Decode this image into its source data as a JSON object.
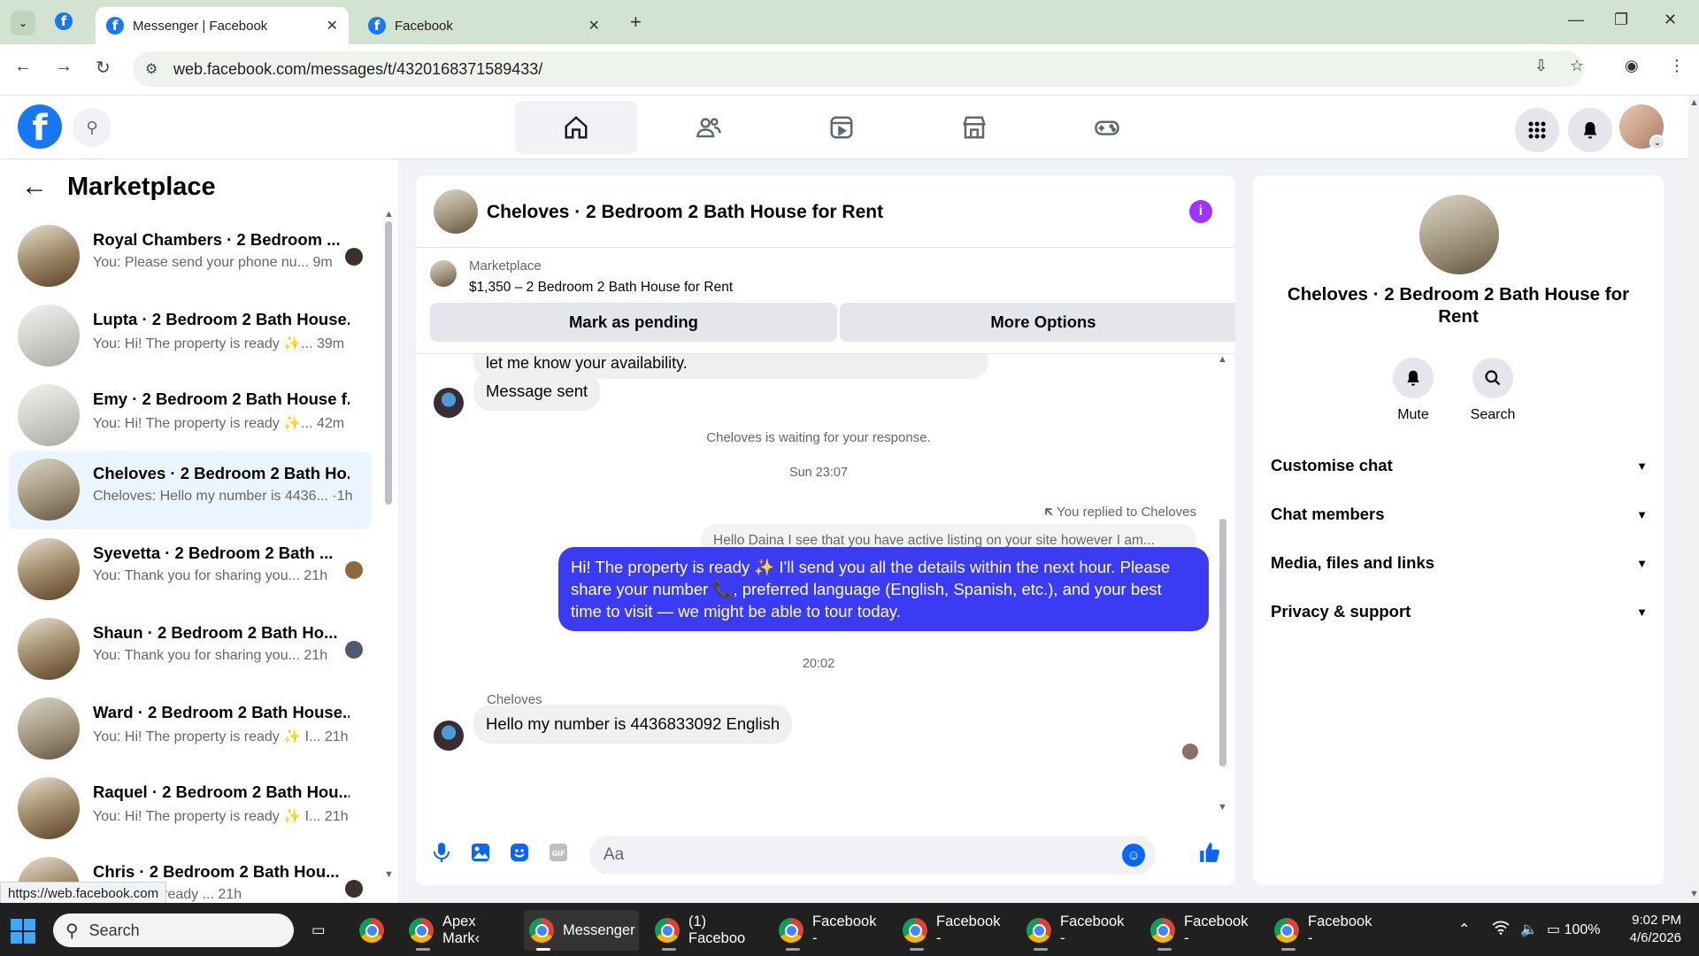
{
  "browser": {
    "tabs": [
      {
        "title": "Messenger | Facebook"
      },
      {
        "title": "Facebook"
      }
    ],
    "url": "web.facebook.com/messages/t/4320168371589433/",
    "status_url": "https://web.facebook.com"
  },
  "sidebar": {
    "title": "Marketplace",
    "conversations": [
      {
        "title": "Royal Chambers · 2 Bedroom ...",
        "preview": "You: Please send your phone nu...",
        "time": "9m"
      },
      {
        "title": "Lupta · 2 Bedroom 2 Bath House...",
        "preview": "You: Hi! The property is ready ✨...",
        "time": "39m"
      },
      {
        "title": "Emy · 2 Bedroom 2 Bath House f...",
        "preview": "You: Hi! The property is ready ✨...",
        "time": "42m"
      },
      {
        "title": "Cheloves · 2 Bedroom 2 Bath Ho...",
        "preview": "Cheloves: Hello my number is 4436...",
        "time": "·1h"
      },
      {
        "title": "Syevetta · 2 Bedroom 2 Bath ...",
        "preview": "You: Thank you for sharing you...",
        "time": "21h"
      },
      {
        "title": "Shaun · 2 Bedroom 2 Bath Ho...",
        "preview": "You: Thank you for sharing you...",
        "time": "21h"
      },
      {
        "title": "Ward · 2 Bedroom 2 Bath House...",
        "preview": "You: Hi! The property is ready ✨ I...",
        "time": "21h"
      },
      {
        "title": "Raquel · 2 Bedroom 2 Bath Hou...",
        "preview": "You: Hi! The property is ready ✨ I...",
        "time": "21h"
      },
      {
        "title": "Chris · 2 Bedroom 2 Bath Hou...",
        "preview": "property is ready ...",
        "time": "21h"
      }
    ]
  },
  "chat": {
    "title": "Cheloves · 2 Bedroom 2 Bath House for Rent",
    "marketplace_label": "Marketplace",
    "listing": "$1,350 – 2 Bedroom 2 Bath House for Rent",
    "mark_pending": "Mark as pending",
    "more_options": "More Options",
    "partial_msg": "let me know your availability.",
    "msg_sent": "Message sent",
    "waiting_note": "Cheloves is waiting for your response.",
    "time1": "Sun 23:07",
    "reply_note": "You replied to Cheloves",
    "quoted": "Hello Daina I see that you have active listing on your site however I am...",
    "outgoing": "Hi! The property is ready ✨ I'll send you all the details within the next hour. Please share your number 📞, preferred language (English, Spanish, etc.), and your best time to visit — we might be able to tour today.",
    "time2": "20:02",
    "sender": "Cheloves",
    "incoming": "Hello my number is 4436833092 English",
    "composer_placeholder": "Aa"
  },
  "details": {
    "title": "Cheloves · 2 Bedroom 2 Bath House for Rent",
    "mute": "Mute",
    "search": "Search",
    "rows": [
      "Customise chat",
      "Chat members",
      "Media, files and links",
      "Privacy & support"
    ]
  },
  "taskbar": {
    "search": "Search",
    "apps": [
      "Apex Mark‹",
      "Messenger",
      "(1) Faceboo",
      "Facebook -",
      "Facebook -",
      "Facebook -",
      "Facebook -",
      "Facebook -"
    ],
    "battery": "100%",
    "time": "9:02 PM",
    "date": "4/6/2026"
  },
  "colors": {
    "fb_blue": "#1877f2",
    "outgoing_bubble": "#3a3bf2",
    "info_purple": "#a033ff"
  }
}
